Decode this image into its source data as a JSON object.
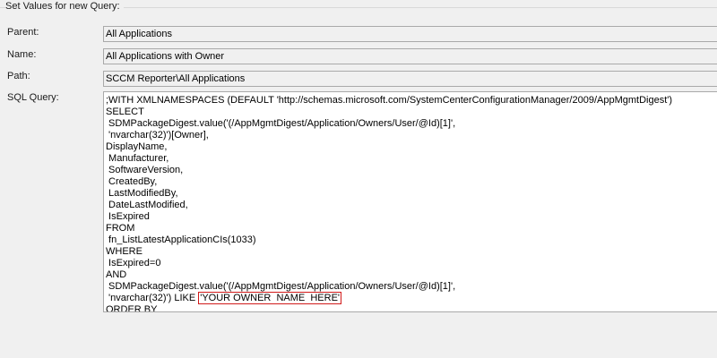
{
  "group": {
    "title": "Set Values for new Query:"
  },
  "fields": {
    "parent": {
      "label": "Parent:",
      "value": "All Applications"
    },
    "name": {
      "label": "Name:",
      "value": "All Applications with Owner"
    },
    "path": {
      "label": "Path:",
      "value": "SCCM Reporter\\All Applications"
    },
    "sql": {
      "label": "SQL Query:"
    }
  },
  "sql_lines": [
    ";WITH XMLNAMESPACES (DEFAULT 'http://schemas.microsoft.com/SystemCenterConfigurationManager/2009/AppMgmtDigest')",
    "SELECT",
    " SDMPackageDigest.value('(/AppMgmtDigest/Application/Owners/User/@Id)[1]',",
    " 'nvarchar(32)')[Owner],",
    "DisplayName,",
    " Manufacturer,",
    " SoftwareVersion,",
    " CreatedBy,",
    " LastModifiedBy,",
    " DateLastModified,",
    " IsExpired",
    "FROM",
    " fn_ListLatestApplicationCIs(1033)",
    "WHERE",
    " IsExpired=0",
    "AND",
    " SDMPackageDigest.value('(/AppMgmtDigest/Application/Owners/User/@Id)[1]',",
    " 'nvarchar(32)') LIKE ",
    "ORDER BY"
  ],
  "sql_highlight": "'YOUR OWNER  NAME  HERE'",
  "colors": {
    "highlight_border": "#d11a1a",
    "window_bg": "#f0f0f0"
  }
}
